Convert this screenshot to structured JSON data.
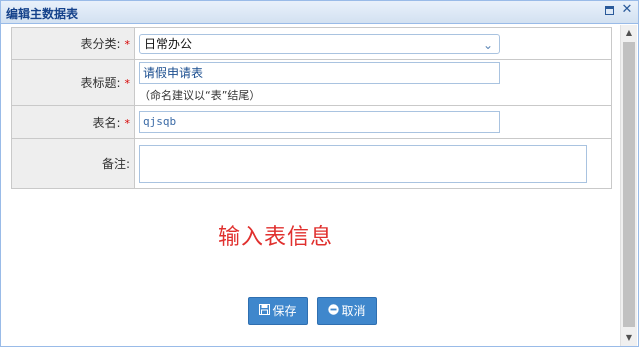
{
  "window": {
    "title": "编辑主数据表",
    "maximize_icon": "maximize-icon",
    "close_icon": "close-icon"
  },
  "form": {
    "category_label": "表分类:",
    "category_value": "日常办公",
    "title_label": "表标题:",
    "title_value": "请假申请表",
    "title_hint": "（命名建议以“表”结尾）",
    "name_label": "表名:",
    "name_value": "qjsqb",
    "remark_label": "备注:",
    "remark_value": "",
    "required_mark": "*"
  },
  "overlay_text": "输入表信息",
  "buttons": {
    "save_label": "保存",
    "cancel_label": "取消"
  },
  "colors": {
    "accent": "#3f87cc",
    "required": "#d60000",
    "overlay": "#e0302e",
    "title_text": "#15428b"
  }
}
